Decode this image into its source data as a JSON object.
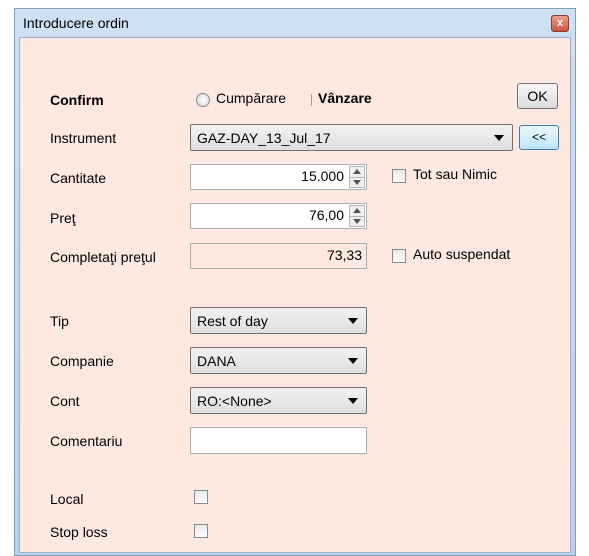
{
  "window": {
    "title": "Introducere ordin",
    "close_symbol": "x"
  },
  "form": {
    "confirm_label": "Confirm",
    "side_buy": "Cumpărare",
    "side_sell": "Vânzare",
    "ok_label": "OK",
    "instrument_label": "Instrument",
    "instrument_value": "GAZ-DAY_13_Jul_17",
    "collapse_label": "<<",
    "quantity_label": "Cantitate",
    "quantity_value": "15.000",
    "all_or_nothing_label": "Tot sau Nimic",
    "price_label": "Preţ",
    "price_value": "76,00",
    "fill_price_label": "Completaţi preţul",
    "fill_price_value": "73,33",
    "auto_suspend_label": "Auto suspendat",
    "type_label": "Tip",
    "type_value": "Rest of day",
    "company_label": "Companie",
    "company_value": "DANA",
    "account_label": "Cont",
    "account_value": "RO:<None>",
    "comment_label": "Comentariu",
    "comment_value": "",
    "local_label": "Local",
    "stop_loss_label": "Stop loss"
  }
}
